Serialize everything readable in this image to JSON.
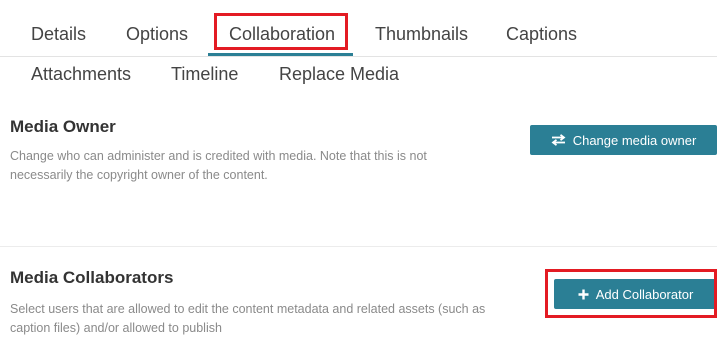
{
  "tabs": {
    "row1": [
      "Details",
      "Options",
      "Collaboration",
      "Thumbnails",
      "Captions"
    ],
    "row2": [
      "Attachments",
      "Timeline",
      "Replace Media"
    ],
    "active": "Collaboration",
    "accent_color": "#2b7f95"
  },
  "media_owner": {
    "title": "Media Owner",
    "description": "Change who can administer and is credited with media. Note that this is not necessarily the copyright owner of the content.",
    "button_label": "Change media owner",
    "button_icon": "swap-arrows-icon"
  },
  "media_collaborators": {
    "title": "Media Collaborators",
    "description": "Select users that are allowed to edit the content metadata and related assets (such as caption files) and/or allowed to publish",
    "button_label": "Add Collaborator",
    "button_icon": "plus-icon"
  },
  "colors": {
    "button_bg": "#2b7f95",
    "highlight": "#e31b23"
  }
}
